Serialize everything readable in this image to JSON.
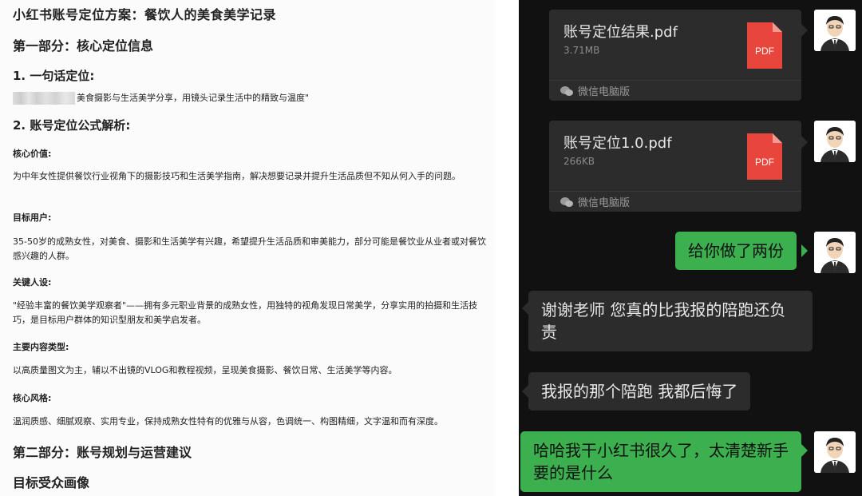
{
  "doc": {
    "title": "小红书账号定位方案：餐饮人的美食美学记录",
    "part1": "第一部分：核心定位信息",
    "oneline_heading": "1. 一句话定位:",
    "oneline_text": "美食摄影与生活美学分享，用镜头记录生活中的精致与温度\"",
    "formula_heading": "2. 账号定位公式解析:",
    "core_value_label": "核心价值:",
    "core_value_text": "为中年女性提供餐饮行业视角下的摄影技巧和生活美学指南，解决想要记录并提升生活品质但不知从何入手的问题。",
    "target_label": "目标用户:",
    "target_text": "35-50岁的成熟女性，对美食、摄影和生活美学有兴趣，希望提升生活品质和审美能力，部分可能是餐饮业从业者或对餐饮感兴趣的人群。",
    "persona_label": "关键人设:",
    "persona_text": "\"经验丰富的餐饮美学观察者\"——拥有多元职业背景的成熟女性，用独特的视角发现日常美学，分享实用的拍摄和生活技巧，是目标用户群体的知识型朋友和美学启发者。",
    "content_label": "主要内容类型:",
    "content_text": "以高质量图文为主，辅以不出镜的VLOG和教程视频，呈现美食摄影、餐饮日常、生活美学等内容。",
    "style_label": "核心风格:",
    "style_text": "温润质感、细腻观察、实用专业，保持成熟女性特有的优雅与从容，色调统一、构图精细，文字温和而有深度。",
    "part2": "第二部分：账号规划与运营建议",
    "audience_heading": "目标受众画像"
  },
  "chat": {
    "file1": {
      "name": "账号定位结果.pdf",
      "size": "3.71MB",
      "source": "微信电脑版"
    },
    "file2": {
      "name": "账号定位1.0.pdf",
      "size": "266KB",
      "source": "微信电脑版"
    },
    "pdf_label": "PDF",
    "msg1": "给你做了两份",
    "msg2": "谢谢老师 您真的比我报的陪跑还负责",
    "msg3": "我报的那个陪跑 我都后悔了",
    "msg4": "哈哈我干小红书很久了，太清楚新手要的是什么",
    "colors": {
      "green": "#3cb04f",
      "bubble_gray": "#2c2c2c",
      "pdf_red": "#e8453c",
      "bg": "#111111"
    }
  }
}
